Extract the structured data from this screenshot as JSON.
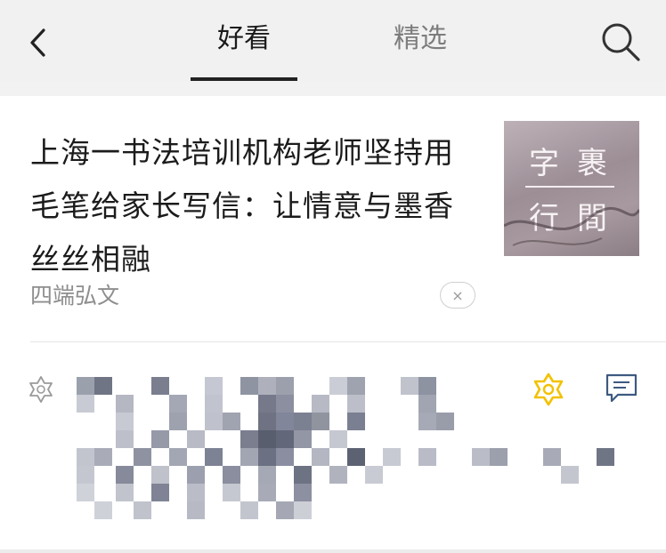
{
  "header": {
    "tabs": [
      {
        "label": "好看",
        "active": true
      },
      {
        "label": "精选",
        "active": false
      }
    ],
    "icons": {
      "back": "chevron-left-icon",
      "search": "search-icon"
    }
  },
  "article": {
    "title": "上海一书法培训机构老师坚持用毛笔给家长写信：让情意与墨香丝丝相融",
    "source": "四端弘文",
    "dismiss_label": "×",
    "thumbnail": {
      "line1": "字裹",
      "line2": "行間"
    }
  },
  "actions": {
    "icons": [
      "wow-icon-outline",
      "wow-icon",
      "comment-icon"
    ],
    "accent_color": "#f2c200"
  }
}
